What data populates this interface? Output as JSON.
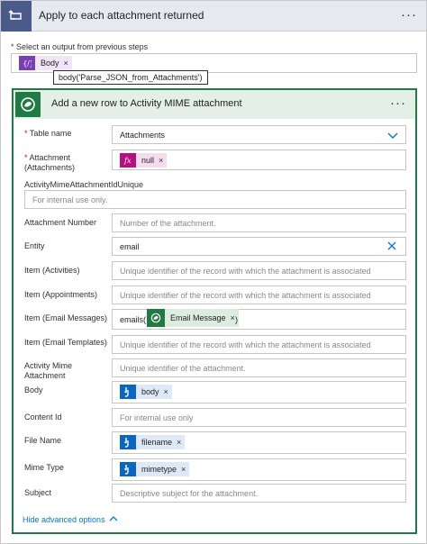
{
  "loop": {
    "title": "Apply to each attachment returned",
    "select_label": "Select an output from previous steps",
    "select_required_mark": "*",
    "token_label": "Body",
    "token_remove": "×",
    "tooltip": "body('Parse_JSON_from_Attachments')"
  },
  "action": {
    "title": "Add a new row to Activity MIME attachment",
    "more_label": "···"
  },
  "fields": {
    "table_name": {
      "required": "*",
      "label": "Table name",
      "value": "Attachments"
    },
    "attachment": {
      "required": "*",
      "label_line1": "Attachment",
      "label_line2": "(Attachments)",
      "token_label": "null",
      "token_remove": "×"
    },
    "unique": {
      "label": "ActivityMimeAttachmentIdUnique",
      "placeholder": "For internal use only."
    },
    "attachment_number": {
      "label": "Attachment Number",
      "placeholder": "Number of the attachment."
    },
    "entity": {
      "label": "Entity",
      "value": "email"
    },
    "item_activities": {
      "label": "Item (Activities)",
      "placeholder": "Unique identifier of the record with which the attachment is associated"
    },
    "item_appointments": {
      "label": "Item (Appointments)",
      "placeholder": "Unique identifier of the record with which the attachment is associated"
    },
    "item_email_messages": {
      "label": "Item (Email Messages)",
      "prefix": "emails(",
      "token_label": "Email Message",
      "token_remove": "×",
      "suffix": ")"
    },
    "item_email_templates": {
      "label": "Item (Email Templates)",
      "placeholder": "Unique identifier of the record with which the attachment is associated"
    },
    "activity_mime": {
      "label_line1": "Activity Mime",
      "label_line2": "Attachment",
      "placeholder": "Unique identifier of the attachment."
    },
    "body": {
      "label": "Body",
      "token_label": "body",
      "token_remove": "×"
    },
    "content_id": {
      "label": "Content Id",
      "placeholder": "For internal use only"
    },
    "file_name": {
      "label": "File Name",
      "token_label": "filename",
      "token_remove": "×"
    },
    "mime_type": {
      "label": "Mime Type",
      "token_label": "mimetype",
      "token_remove": "×"
    },
    "subject": {
      "label": "Subject",
      "placeholder": "Descriptive subject for the attachment."
    }
  },
  "footer": {
    "hide_advanced": "Hide advanced options"
  },
  "colors": {
    "loop_icon_bg": "#4a5b8b",
    "action_accent": "#1f7a43",
    "action_header_bg": "#e3efe7",
    "json_token_bg": "#efe6f7",
    "json_token_icon": "#7b3fb5",
    "expr_token_bg": "#f7dcef",
    "expr_token_icon": "#b5107f",
    "dataverse_token_bg": "#dcecdf",
    "http_token_bg": "#dde9f7",
    "http_token_icon": "#0a66c2",
    "link": "#0078d4"
  },
  "icons": [
    "loop-icon",
    "parse-json-icon",
    "dataverse-icon",
    "fx-icon",
    "http-icon",
    "chevron-down-icon",
    "chevron-up-icon",
    "clear-icon",
    "more-icon"
  ]
}
